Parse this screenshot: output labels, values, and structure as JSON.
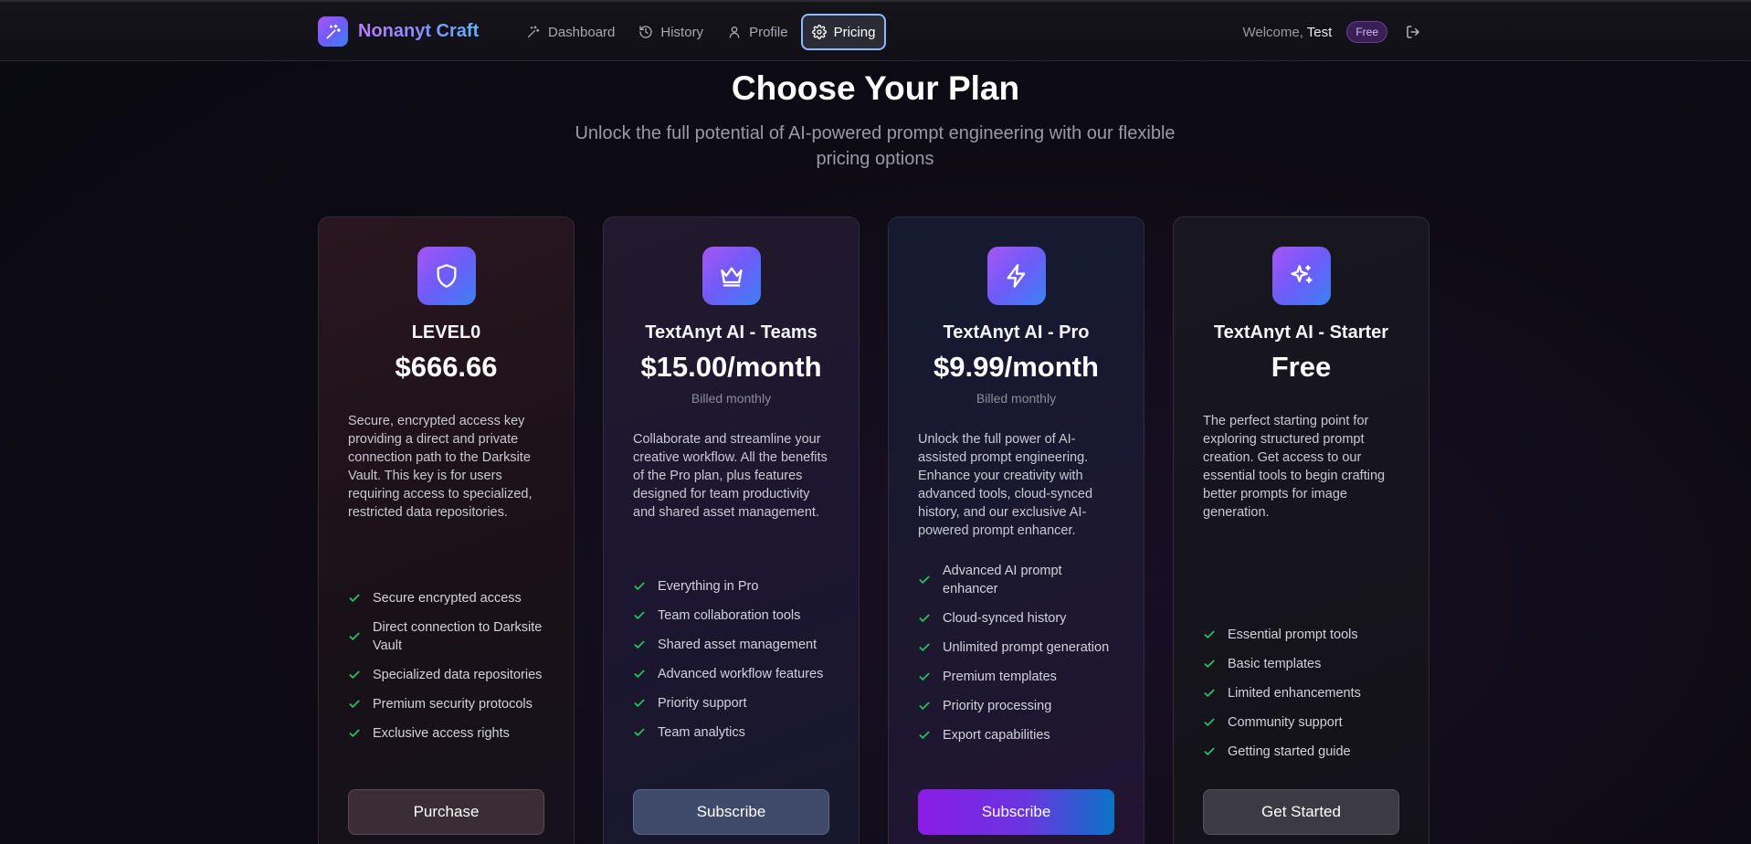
{
  "brand": {
    "name": "Nonanyt Craft",
    "logo_icon": "sparkles-icon"
  },
  "nav": {
    "items": [
      {
        "label": "Dashboard",
        "icon": "sparkles-icon"
      },
      {
        "label": "History",
        "icon": "history-icon"
      },
      {
        "label": "Profile",
        "icon": "user-icon"
      },
      {
        "label": "Pricing",
        "icon": "gear-icon",
        "active": true
      }
    ]
  },
  "user": {
    "welcome_prefix": "Welcome,",
    "name": "Test",
    "plan_badge": "Free"
  },
  "hero": {
    "title": "Choose Your Plan",
    "subtitle": "Unlock the full potential of AI-powered prompt engineering with our flexible pricing options"
  },
  "plans": [
    {
      "icon": "shield-icon",
      "name": "LEVEL0",
      "price": "$666.66",
      "billed": "",
      "description": "Secure, encrypted access key providing a direct and private connection path to the Darksite Vault. This key is for users requiring access to specialized, restricted data repositories.",
      "features": [
        "Secure encrypted access",
        "Direct connection to Darksite Vault",
        "Specialized data repositories",
        "Premium security protocols",
        "Exclusive access rights"
      ],
      "cta": "Purchase"
    },
    {
      "icon": "crown-icon",
      "name": "TextAnyt AI - Teams",
      "price": "$15.00/month",
      "billed": "Billed monthly",
      "description": "Collaborate and streamline your creative workflow. All the benefits of the Pro plan, plus features designed for team productivity and shared asset management.",
      "features": [
        "Everything in Pro",
        "Team collaboration tools",
        "Shared asset management",
        "Advanced workflow features",
        "Priority support",
        "Team analytics"
      ],
      "cta": "Subscribe"
    },
    {
      "icon": "lightning-icon",
      "name": "TextAnyt AI - Pro",
      "price": "$9.99/month",
      "billed": "Billed monthly",
      "description": "Unlock the full power of AI-assisted prompt engineering. Enhance your creativity with advanced tools, cloud-synced history, and our exclusive AI-powered prompt enhancer.",
      "features": [
        "Advanced AI prompt enhancer",
        "Cloud-synced history",
        "Unlimited prompt generation",
        "Premium templates",
        "Priority processing",
        "Export capabilities"
      ],
      "cta": "Subscribe"
    },
    {
      "icon": "sparkles-icon",
      "name": "TextAnyt AI - Starter",
      "price": "Free",
      "billed": "",
      "description": "The perfect starting point for exploring structured prompt creation. Get access to our essential tools to begin crafting better prompts for image generation.",
      "features": [
        "Essential prompt tools",
        "Basic templates",
        "Limited enhancements",
        "Community support",
        "Getting started guide"
      ],
      "cta": "Get Started"
    }
  ],
  "colors": {
    "accent_purple": "#a855f7",
    "accent_blue": "#3b82f6",
    "check_green": "#22c55e"
  }
}
